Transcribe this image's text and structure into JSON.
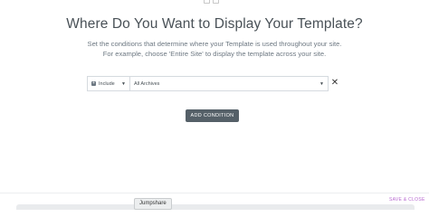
{
  "modal": {
    "title": "Where Do You Want to Display Your Template?",
    "description_line1": "Set the conditions that determine where your Template is used throughout your site.",
    "description_line2": "For example, choose 'Entire Site' to display the template across your site."
  },
  "condition": {
    "type_badge": "+",
    "type_value": "Include",
    "sub_value": "All Archives",
    "caret": "▼",
    "remove": "✕"
  },
  "add_button_label": "ADD CONDITION",
  "footer": {
    "jumpshare_label": "Jumpshare",
    "save_close_label": "SAVE & CLOSE"
  },
  "colors": {
    "button_bg": "#556068",
    "accent_save": "#b86ad1"
  }
}
